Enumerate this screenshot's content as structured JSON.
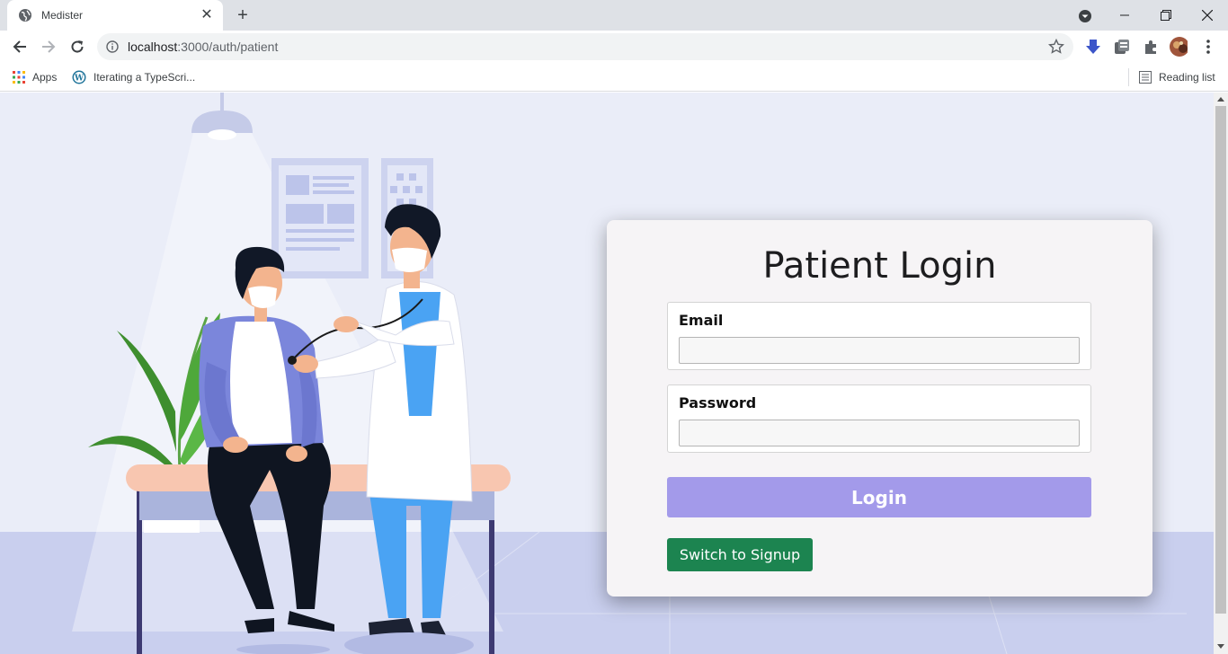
{
  "browser": {
    "tab_title": "Medister",
    "url_host": "localhost",
    "url_rest": ":3000/auth/patient",
    "bookmarks": {
      "apps_label": "Apps",
      "item1_label": "Iterating a TypeScri...",
      "reading_list_label": "Reading list"
    }
  },
  "login": {
    "title": "Patient Login",
    "email_label": "Email",
    "email_value": "",
    "password_label": "Password",
    "password_value": "",
    "login_button": "Login",
    "switch_button": "Switch to Signup"
  },
  "colors": {
    "page_bg": "#eaedf8",
    "login_button": "#a39aea",
    "switch_button": "#1c8450"
  }
}
